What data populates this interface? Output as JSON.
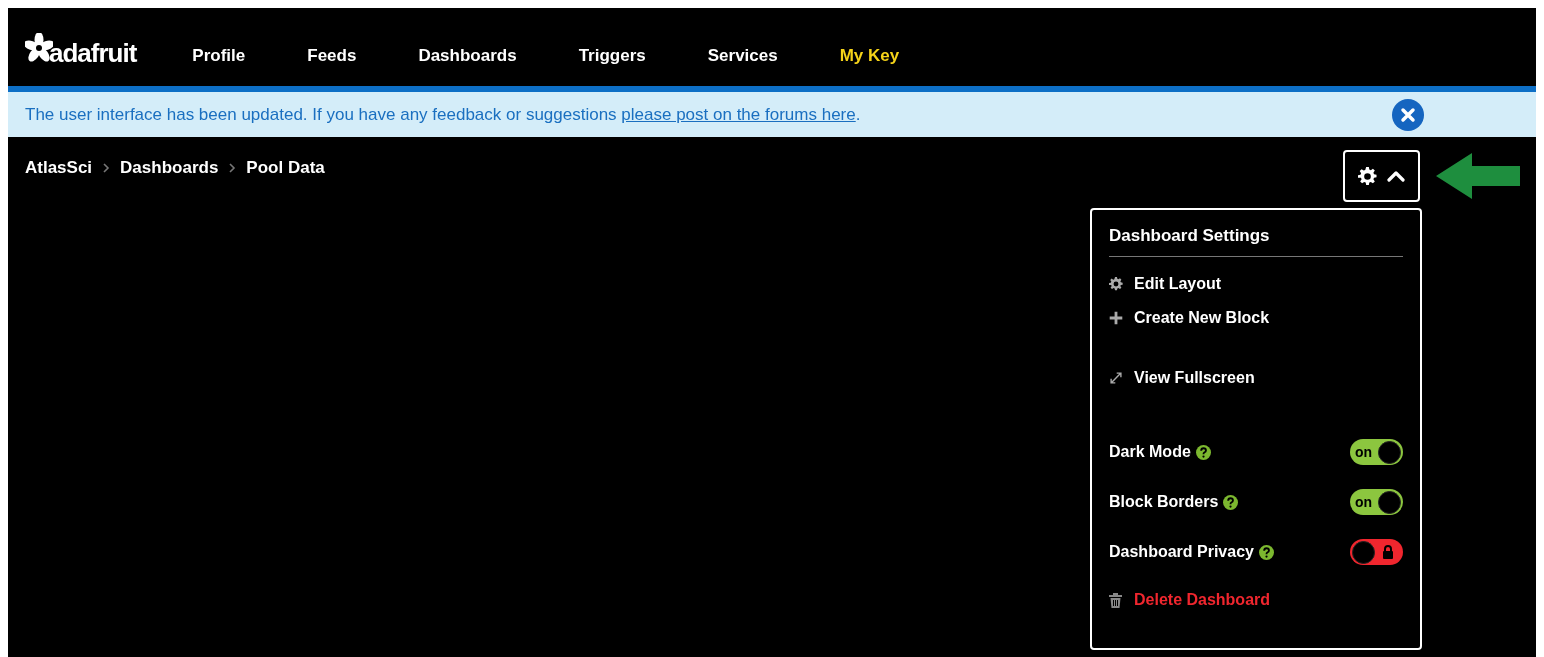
{
  "nav": {
    "logo_text": "adafruit",
    "items": [
      {
        "label": "Profile",
        "highlighted": false
      },
      {
        "label": "Feeds",
        "highlighted": false
      },
      {
        "label": "Dashboards",
        "highlighted": false
      },
      {
        "label": "Triggers",
        "highlighted": false
      },
      {
        "label": "Services",
        "highlighted": false
      },
      {
        "label": "My Key",
        "highlighted": true
      }
    ]
  },
  "banner": {
    "text": "The user interface has been updated. If you have any feedback or suggestions ",
    "link": "please post on the forums here",
    "after": "."
  },
  "breadcrumb": [
    "AtlasSci",
    "Dashboards",
    "Pool Data"
  ],
  "settings_menu": {
    "expanded": true,
    "title": "Dashboard Settings",
    "items": [
      {
        "kind": "action",
        "label": "Edit Layout"
      },
      {
        "kind": "action",
        "label": "Create New Block"
      },
      {
        "kind": "action",
        "label": "View Fullscreen"
      },
      {
        "kind": "toggle",
        "label": "Dark Mode",
        "on": true,
        "toggle_text": "on"
      },
      {
        "kind": "toggle",
        "label": "Block Borders",
        "on": true,
        "toggle_text": "on"
      },
      {
        "kind": "toggle",
        "label": "Dashboard Privacy",
        "on": false
      },
      {
        "kind": "danger",
        "label": "Delete Dashboard"
      }
    ]
  }
}
